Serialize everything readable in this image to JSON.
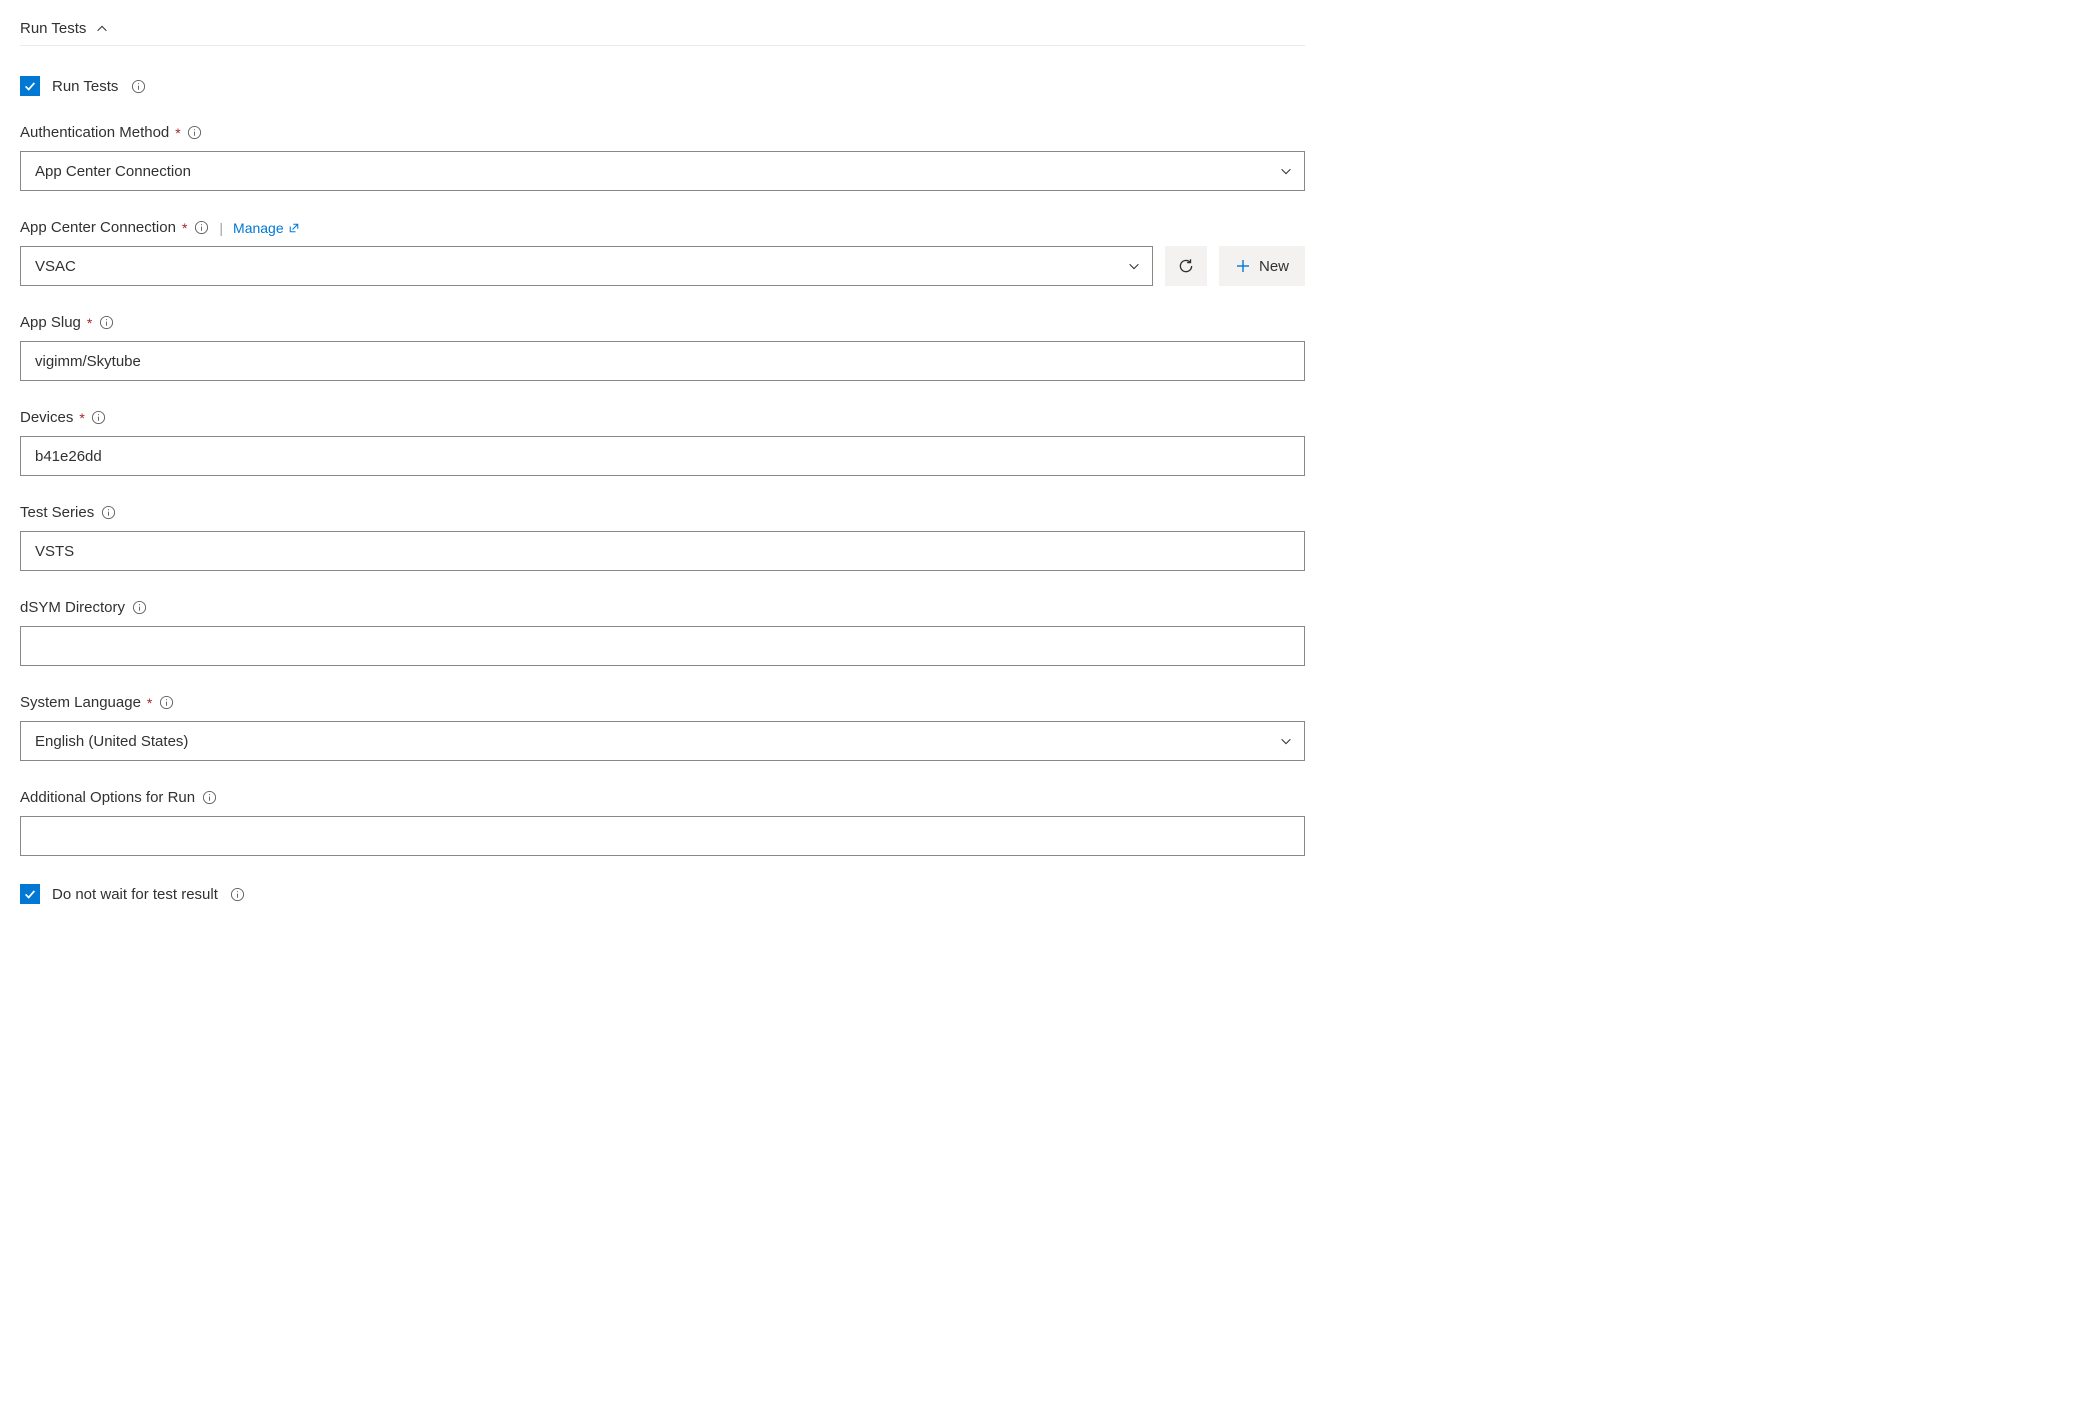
{
  "section": {
    "title": "Run Tests"
  },
  "fields": {
    "run_tests": {
      "label": "Run Tests",
      "checked": true
    },
    "auth_method": {
      "label": "Authentication Method",
      "required": true,
      "value": "App Center Connection"
    },
    "app_center_connection": {
      "label": "App Center Connection",
      "required": true,
      "manage_text": "Manage",
      "value": "VSAC",
      "new_button": "New"
    },
    "app_slug": {
      "label": "App Slug",
      "required": true,
      "value": "vigimm/Skytube"
    },
    "devices": {
      "label": "Devices",
      "required": true,
      "value": "b41e26dd"
    },
    "test_series": {
      "label": "Test Series",
      "required": false,
      "value": "VSTS"
    },
    "dsym_directory": {
      "label": "dSYM Directory",
      "required": false,
      "value": ""
    },
    "system_language": {
      "label": "System Language",
      "required": true,
      "value": "English (United States)"
    },
    "additional_options": {
      "label": "Additional Options for Run",
      "required": false,
      "value": ""
    },
    "do_not_wait": {
      "label": "Do not wait for test result",
      "checked": true
    }
  }
}
